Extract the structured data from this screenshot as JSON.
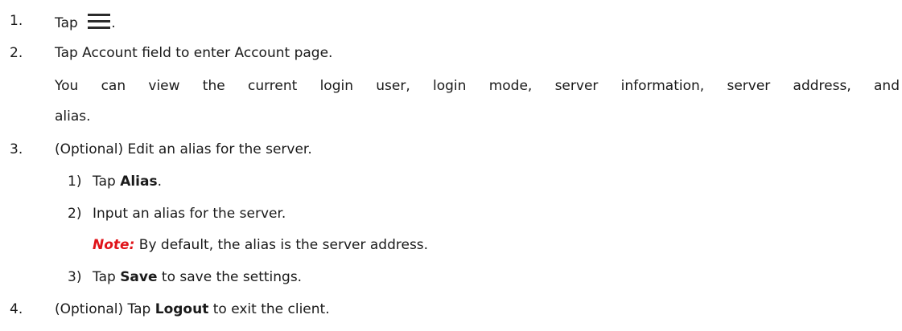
{
  "steps": [
    {
      "number": "1.",
      "text_before": "Tap",
      "icon": "menu-icon",
      "text_after": "."
    },
    {
      "number": "2.",
      "text": "Tap Account field to enter Account page.",
      "para_line1": "You can view the current login user, login mode, server information, server address, and",
      "para_line2": "alias."
    },
    {
      "number": "3.",
      "text": "(Optional) Edit an alias for the server.",
      "substeps": [
        {
          "number": "1)",
          "prefix": "Tap ",
          "bold": "Alias",
          "suffix": "."
        },
        {
          "number": "2)",
          "text": "Input an alias for the server."
        },
        {
          "number": "3)",
          "prefix": "Tap ",
          "bold": "Save",
          "suffix": " to save the settings."
        }
      ],
      "note_label": "Note:",
      "note_text": " By default, the alias is the server address."
    },
    {
      "number": "4.",
      "prefix": "(Optional) Tap ",
      "bold": "Logout",
      "suffix": " to exit the client."
    }
  ],
  "colors": {
    "text": "#1a1a1a",
    "note": "#e0141a"
  }
}
